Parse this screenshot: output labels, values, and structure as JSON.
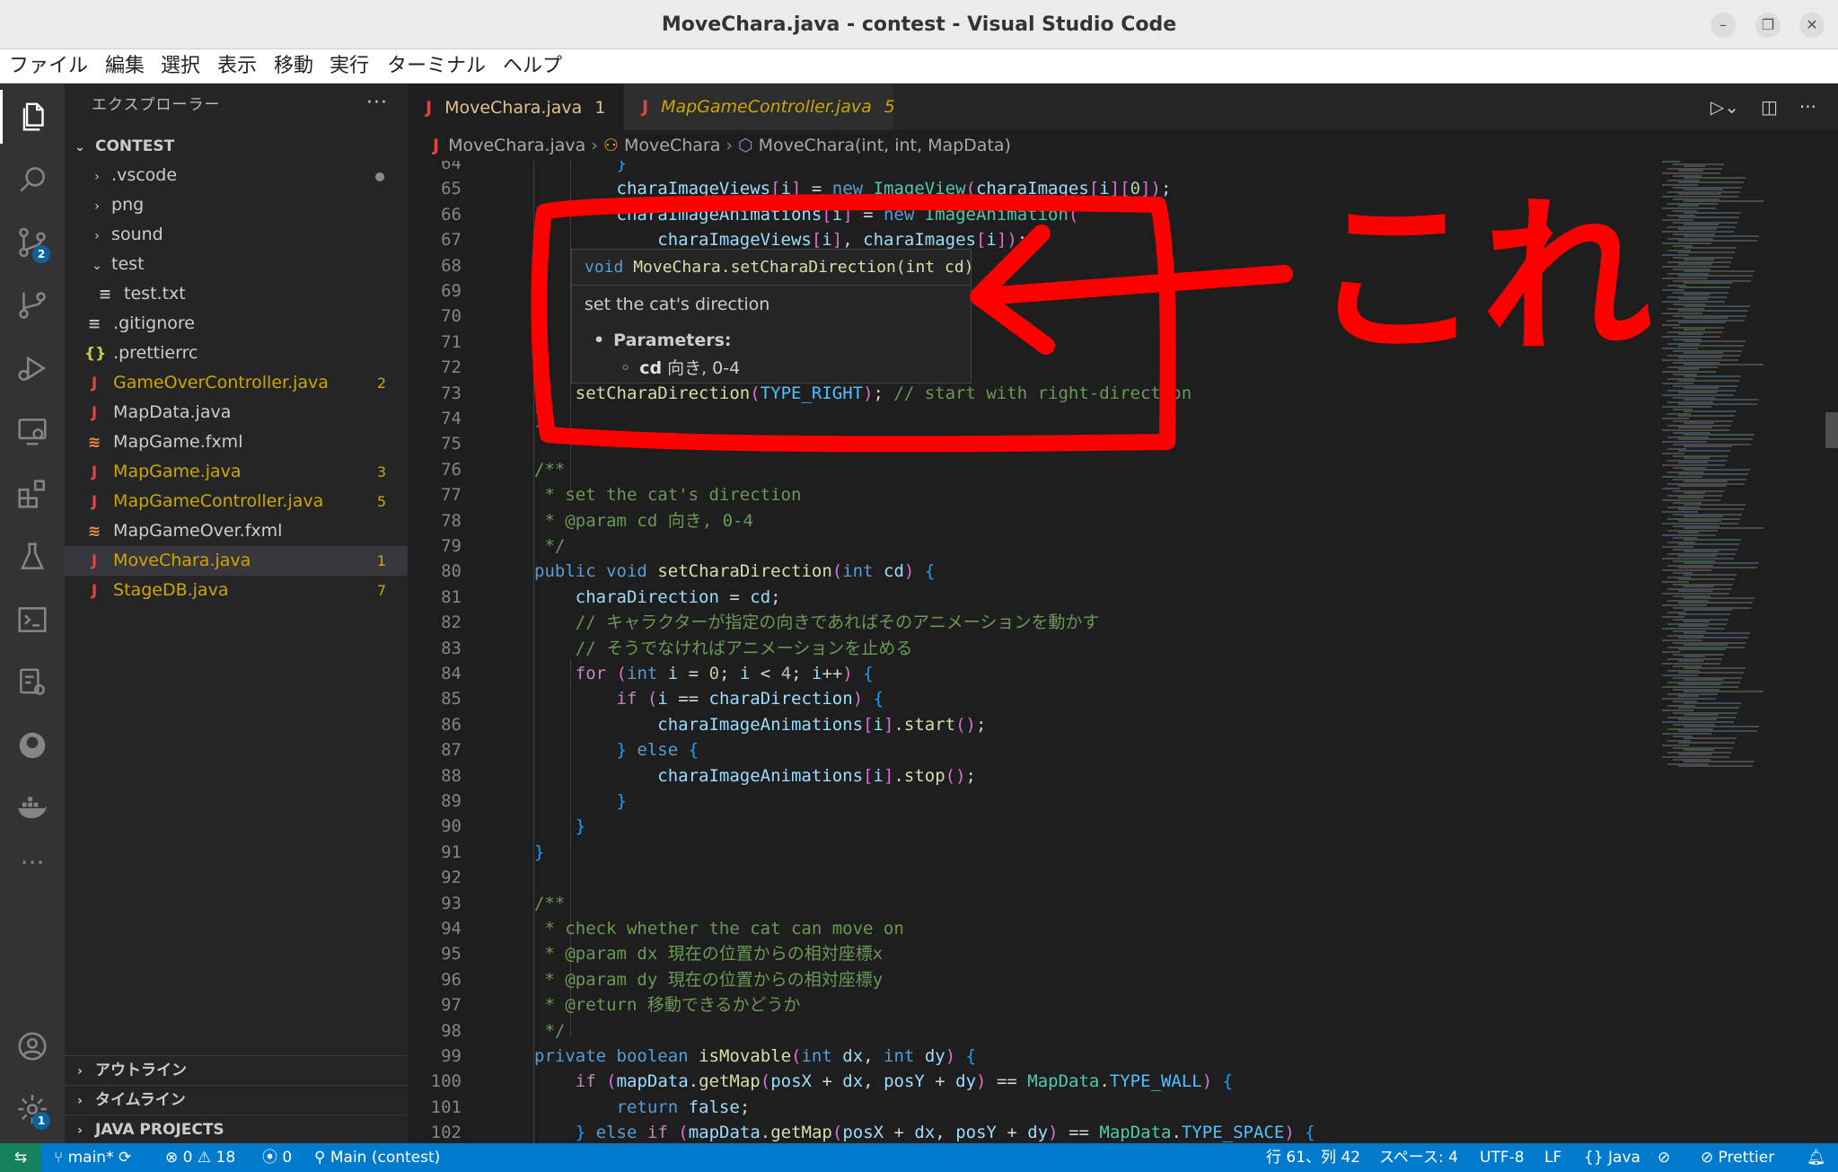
{
  "window": {
    "title": "MoveChara.java - contest - Visual Studio Code",
    "min": "–",
    "max": "❐",
    "close": "✕"
  },
  "menu": [
    "ファイル",
    "編集",
    "選択",
    "表示",
    "移動",
    "実行",
    "ターミナル",
    "ヘルプ"
  ],
  "activity": {
    "icons": [
      "explorer-icon",
      "search-icon",
      "source-control-icon",
      "git-graph-icon",
      "run-debug-icon",
      "remote-explorer-icon",
      "extensions-icon",
      "testing-icon",
      "terminal-icon",
      "settings-sync-icon",
      "github-icon",
      "docker-icon",
      "more-icon"
    ],
    "source_control_badge": "2",
    "manage_badge": "1",
    "more": "···"
  },
  "sidebar": {
    "title": "エクスプローラー",
    "more": "···",
    "root": "CONTEST",
    "items": [
      {
        "label": ".vscode",
        "kind": "folder-collapsed",
        "badge": ""
      },
      {
        "label": "png",
        "kind": "folder-collapsed",
        "badge": ""
      },
      {
        "label": "sound",
        "kind": "folder-collapsed",
        "badge": ""
      },
      {
        "label": "test",
        "kind": "folder-expanded",
        "badge": ""
      },
      {
        "label": "test.txt",
        "kind": "txt",
        "badge": ""
      },
      {
        "label": ".gitignore",
        "kind": "txt",
        "badge": ""
      },
      {
        "label": ".prettierrc",
        "kind": "json",
        "badge": ""
      },
      {
        "label": "GameOverController.java",
        "kind": "java",
        "badge": "2"
      },
      {
        "label": "MapData.java",
        "kind": "java",
        "badge": ""
      },
      {
        "label": "MapGame.fxml",
        "kind": "xml",
        "badge": ""
      },
      {
        "label": "MapGame.java",
        "kind": "java",
        "badge": "3"
      },
      {
        "label": "MapGameController.java",
        "kind": "java",
        "badge": "5"
      },
      {
        "label": "MapGameOver.fxml",
        "kind": "xml",
        "badge": ""
      },
      {
        "label": "MoveChara.java",
        "kind": "java",
        "badge": "1"
      },
      {
        "label": "StageDB.java",
        "kind": "java",
        "badge": "7"
      }
    ],
    "bottom_sections": [
      "アウトライン",
      "タイムライン",
      "JAVA PROJECTS"
    ]
  },
  "tabs": [
    {
      "label": "MoveChara.java",
      "problems": "1",
      "active": true
    },
    {
      "label": "MapGameController.java",
      "problems": "5",
      "active": false
    }
  ],
  "breadcrumb": [
    "MoveChara.java",
    "MoveChara",
    "MoveChara(int, int, MapData)"
  ],
  "hover": {
    "signature_kw": "void",
    "signature_rest": " MoveChara.setCharaDirection(int cd)",
    "description": "set the cat's direction",
    "params_header": "Parameters:",
    "param_name": "cd",
    "param_desc": "向き, 0-4"
  },
  "annotation": {
    "text": "これ",
    "color": "#ff0000"
  },
  "code": {
    "first_line": 64,
    "lines": [
      "        }",
      "        charaImageViews[i] = new ImageView(charaImages[i][0]);",
      "        charaImageAnimations[i] = new ImageAnimation(",
      "            charaImageViews[i], charaImages[i]);",
      "",
      "",
      "",
      "",
      "",
      "    setCharaDirection(TYPE_RIGHT); // start with right-direction",
      "}",
      "",
      "/**",
      " * set the cat's direction",
      " * @param cd 向き, 0-4",
      " */",
      "public void setCharaDirection(int cd) {",
      "    charaDirection = cd;",
      "    // キャラクターが指定の向きであればそのアニメーションを動かす",
      "    // そうでなければアニメーションを止める",
      "    for (int i = 0; i < 4; i++) {",
      "        if (i == charaDirection) {",
      "            charaImageAnimations[i].start();",
      "        } else {",
      "            charaImageAnimations[i].stop();",
      "        }",
      "    }",
      "}",
      "",
      "/**",
      " * check whether the cat can move on",
      " * @param dx 現在の位置からの相対座標x",
      " * @param dy 現在の位置からの相対座標y",
      " * @return 移動できるかどうか",
      " */",
      "private boolean isMovable(int dx, int dy) {",
      "    if (mapData.getMap(posX + dx, posY + dy) == MapData.TYPE_WALL) {",
      "        return false;",
      "    } else if (mapData.getMap(posX + dx, posY + dy) == MapData.TYPE_SPACE) {"
    ]
  },
  "status": {
    "remote": "⇆",
    "branch": "main*",
    "sync": "⟳",
    "errors": "0",
    "warnings": "18",
    "ports": "0",
    "run": "Main (contest)",
    "position": "行 61、列 42",
    "spaces": "スペース: 4",
    "encoding": "UTF-8",
    "eol": "LF",
    "language": "Java",
    "prettier": "Prettier"
  }
}
